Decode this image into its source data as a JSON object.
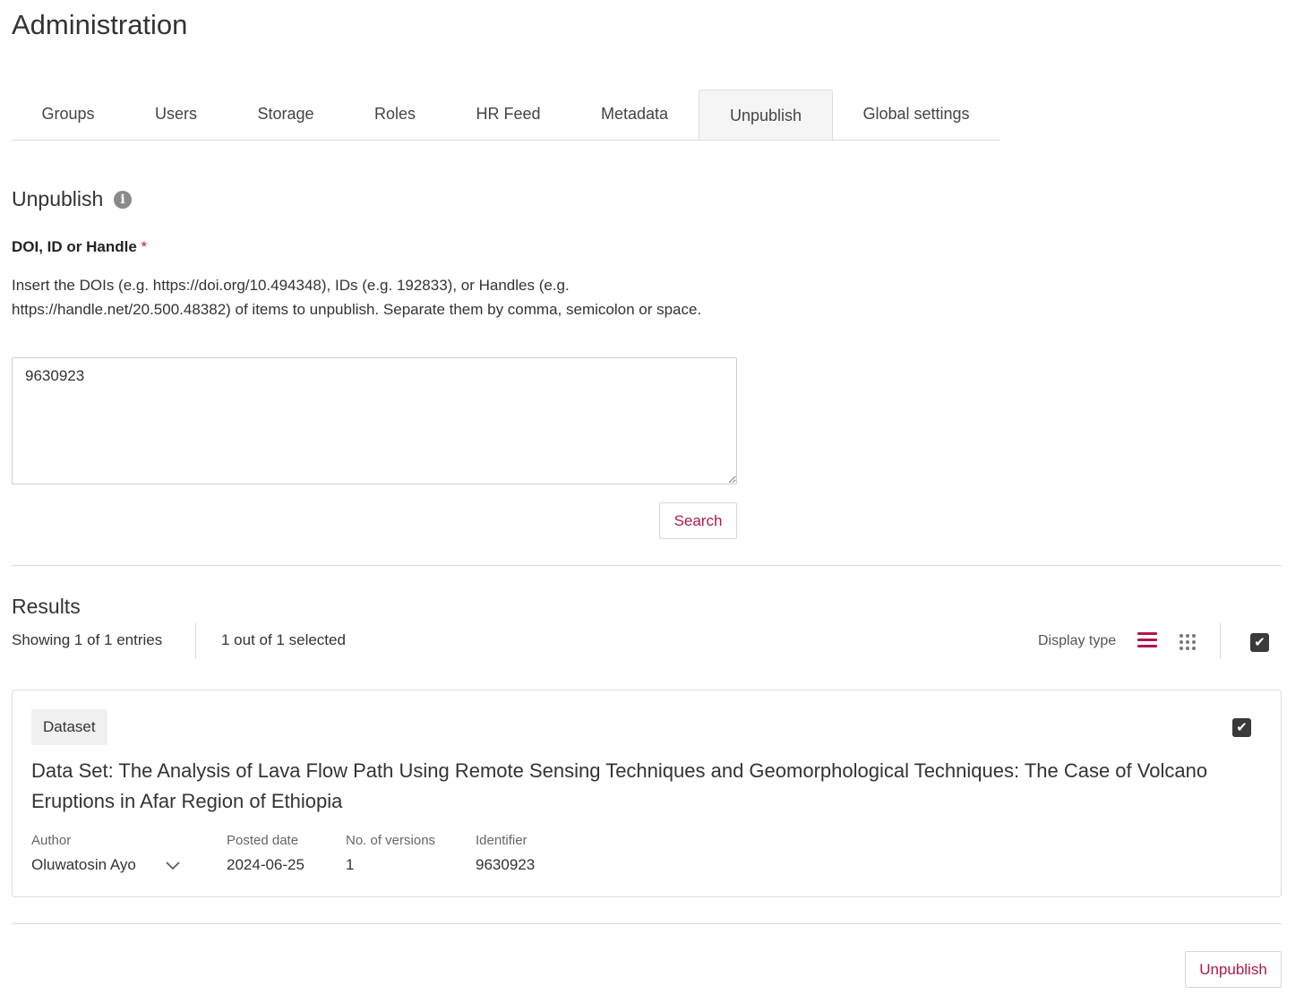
{
  "header": {
    "title": "Administration"
  },
  "tabs": [
    {
      "label": "Groups"
    },
    {
      "label": "Users"
    },
    {
      "label": "Storage"
    },
    {
      "label": "Roles"
    },
    {
      "label": "HR Feed"
    },
    {
      "label": "Metadata"
    },
    {
      "label": "Unpublish",
      "active": true
    },
    {
      "label": "Global settings"
    }
  ],
  "unpublish": {
    "title": "Unpublish",
    "info_icon": "info-icon",
    "field_label": "DOI, ID or Handle",
    "required_mark": "*",
    "help_text": "Insert the DOIs (e.g. https://doi.org/10.494348), IDs (e.g. 192833), or Handles (e.g. https://handle.net/20.500.48382) of items to unpublish. Separate them by comma, semicolon or space.",
    "input_value": "9630923",
    "search_label": "Search"
  },
  "results": {
    "title": "Results",
    "showing": "Showing 1 of 1 entries",
    "selected": "1 out of 1 selected",
    "display_type_label": "Display type",
    "display_type_selected": "list",
    "select_all_checked": true,
    "items": [
      {
        "type_badge": "Dataset",
        "checked": true,
        "title": "Data Set: The Analysis of Lava Flow Path Using Remote Sensing Techniques and Geomorphological Techniques: The Case of Volcano Eruptions in Afar Region of Ethiopia",
        "author_label": "Author",
        "author": "Oluwatosin Ayo",
        "posted_label": "Posted date",
        "posted": "2024-06-25",
        "versions_label": "No. of versions",
        "versions": "1",
        "identifier_label": "Identifier",
        "identifier": "9630923"
      }
    ]
  },
  "footer": {
    "unpublish_label": "Unpublish"
  },
  "colors": {
    "accent": "#b0174f",
    "border": "#dddddd",
    "active_tab_bg": "#f5f5f5",
    "checkbox_bg": "#3a3a3a"
  }
}
